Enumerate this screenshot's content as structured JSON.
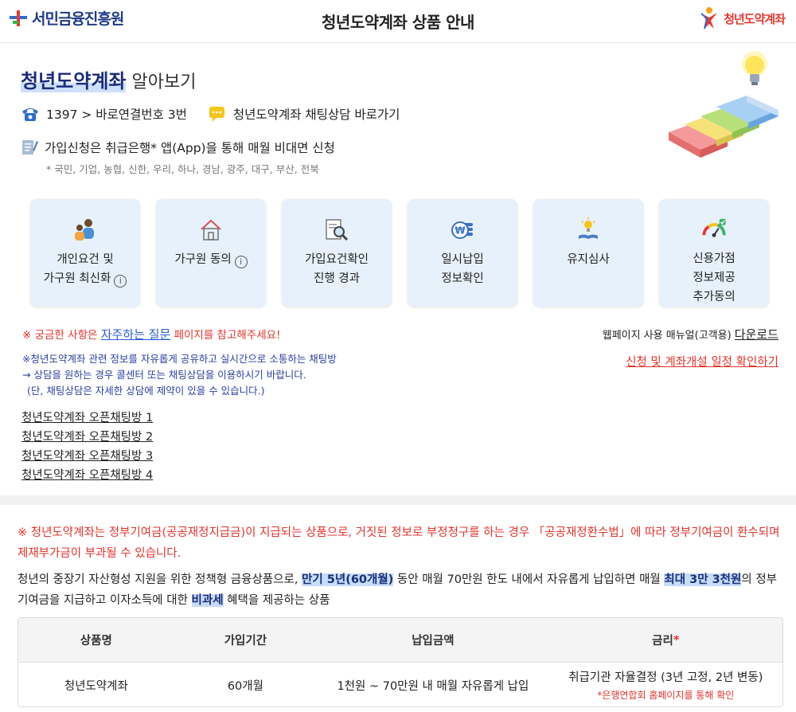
{
  "header": {
    "org_logo_text": "서민금융진흥원",
    "title": "청년도약계좌 상품 안내",
    "product_logo_text": "청년도약계좌"
  },
  "intro": {
    "title_highlight": "청년도약계좌",
    "title_rest": " 알아보기",
    "phone_text": "1397 > 바로연결번호 3번",
    "chat_text": "청년도약계좌 채팅상담 바로가기",
    "apply_text": "가입신청은 취급은행* 앱(App)을 통해 매월 비대면 신청",
    "banks_text": "* 국민, 기업, 농협, 신한, 우리, 하나, 경남, 광주, 대구, 부산, 전북"
  },
  "cards": [
    {
      "label": "개인요건 및\n가구원 최신화",
      "icon": "people-icon",
      "info": true
    },
    {
      "label": "가구원 동의",
      "icon": "house-icon",
      "info": true
    },
    {
      "label": "가입요건확인\n진행 경과",
      "icon": "document-search-icon",
      "info": false
    },
    {
      "label": "일시납입\n정보확인",
      "icon": "won-coin-icon",
      "info": false
    },
    {
      "label": "유지심사",
      "icon": "book-bulb-icon",
      "info": false
    },
    {
      "label": "신용가점\n정보제공\n추가동의",
      "icon": "gauge-icon",
      "info": false
    }
  ],
  "info_symbol": "i",
  "notes": {
    "faq_prefix": "※ 궁금한 사항은 ",
    "faq_link": "자주하는 질문",
    "faq_suffix": " 페이지를 참고해주세요!",
    "manual_prefix": "웹페이지 사용 매뉴얼(고객용) ",
    "manual_link": "다운로드",
    "schedule_link": "신청 및 계좌개설 일정 확인하기",
    "chat_line1": "※청년도약계좌 관련 정보를 자유롭게 공유하고 실시간으로 소통하는 채팅방",
    "chat_line2": "→ 상담을 원하는 경우 콜센터 또는 채팅상담을 이용하시기 바랍니다.",
    "chat_line3": "(단, 채팅상담은 자세한 상담에 제약이 있을 수 있습니다.)",
    "chat_rooms": [
      "청년도약계좌 오픈채팅방 1",
      "청년도약계좌 오픈채팅방 2",
      "청년도약계좌 오픈채팅방 3",
      "청년도약계좌 오픈채팅방 4"
    ]
  },
  "product": {
    "warning": "※ 청년도약계좌는 정부기여금(공공재정지급금)이 지급되는 상품으로, 거짓된 정보로 부정청구를 하는 경우 「공공재정환수법」에 따라 정부기여금이 환수되며 제재부가금이 부과될 수 있습니다.",
    "desc_1": "청년의 중장기 자산형성 지원을 위한 정책형 금융상품으로, ",
    "desc_mark1": "만기 5년(60개월)",
    "desc_2": " 동안 매월 70만원 한도 내에서 자유롭게 납입하면 매월 ",
    "desc_mark2": "최대 3만 3천원",
    "desc_3": "의 정부기여금을 지급하고 이자소득에 대한 ",
    "desc_mark3": "비과세",
    "desc_4": " 혜택을 제공하는 상품"
  },
  "table": {
    "headers": [
      "상품명",
      "가입기간",
      "납입금액",
      "금리"
    ],
    "required_mark": "*",
    "row": [
      "청년도약계좌",
      "60개월",
      "1천원 ~ 70만원 내 매월 자유롭게 납입",
      "취급기관 자율결정 (3년 고정, 2년 변동)"
    ],
    "rate_note": "*은행연합회 홈페이지를 통해 확인"
  },
  "colors": {
    "accent_red": "#e4332b",
    "navy": "#1a2d7c",
    "card_bg": "#e7f1fb",
    "link_blue": "#2a5bd7"
  }
}
